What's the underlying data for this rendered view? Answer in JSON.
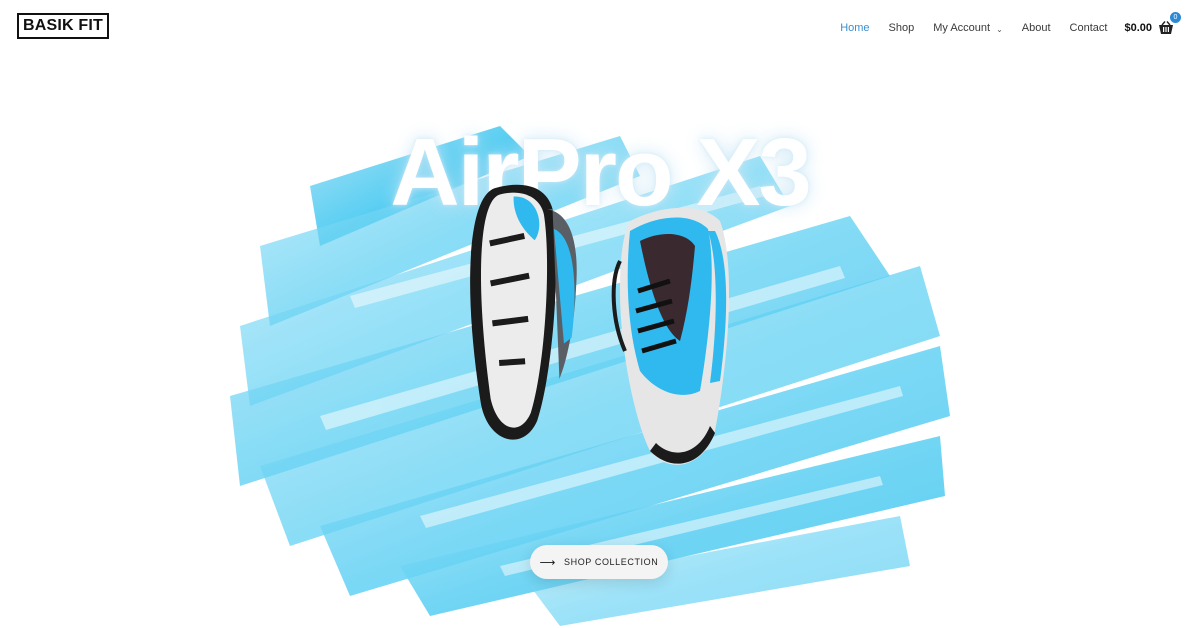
{
  "header": {
    "logo_text": "BASIK FIT",
    "nav": [
      {
        "label": "Home",
        "active": true
      },
      {
        "label": "Shop",
        "active": false
      },
      {
        "label": "My Account",
        "active": false
      },
      {
        "label": "About",
        "active": false
      },
      {
        "label": "Contact",
        "active": false
      }
    ],
    "cart_total": "$0.00",
    "cart_count": "0"
  },
  "hero": {
    "title": "AirPro X3",
    "cta_label": "SHOP COLLECTION",
    "accent_color": "#35c3ef"
  },
  "icons": {
    "cart": "shopping-basket-icon",
    "chevron": "chevron-down-icon",
    "arrow": "arrow-right-icon"
  }
}
